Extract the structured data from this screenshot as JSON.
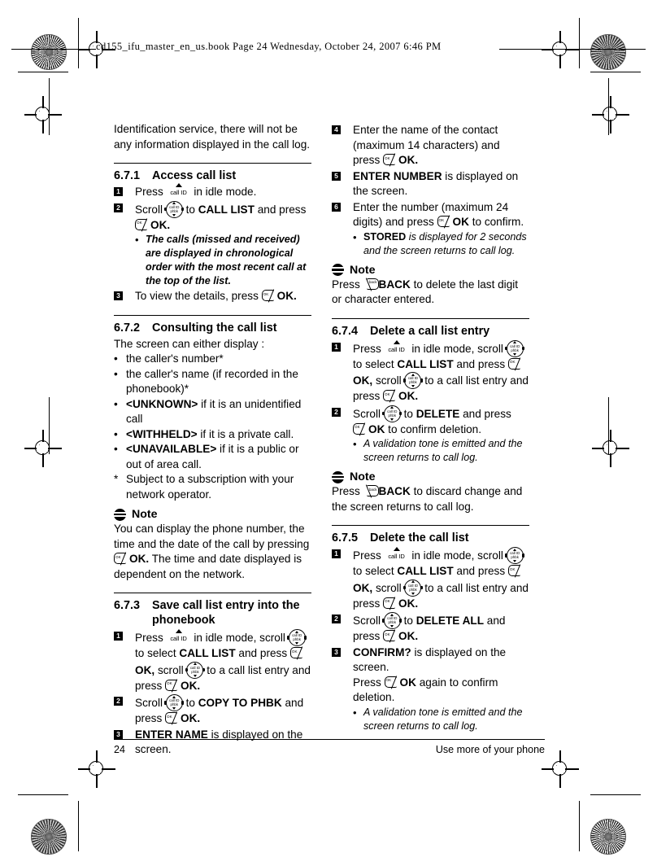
{
  "header": {
    "text": "cd155_ifu_master_en_us.book  Page 24  Wednesday, October 24, 2007  6:46 PM"
  },
  "footer": {
    "page_number": "24",
    "chapter_title": "Use more of your phone"
  },
  "keys": {
    "callid_label": "call ID",
    "nav_top": "call ID",
    "nav_bottom": "phbk",
    "ok_label": "OK",
    "back_label": "back"
  },
  "left_column": {
    "intro": "Identification service, there will not be any information displayed in the call log.",
    "section_671": {
      "number": "6.7.1",
      "title": "Access call list",
      "step1_a": "Press",
      "step1_b": "in idle mode.",
      "step2_a": "Scroll",
      "step2_b": "to",
      "step2_target": "CALL LIST",
      "step2_c": "and press",
      "step2_ok": "OK.",
      "step2_bullet": "The calls (missed and received) are displayed in chronological order with the most recent call at the top of the list.",
      "step3_a": "To view the details, press",
      "step3_ok": "OK."
    },
    "section_672": {
      "number": "6.7.2",
      "title": "Consulting the call list",
      "lead": "The screen can either display :",
      "bullets": [
        {
          "plain": "the caller's number*"
        },
        {
          "plain": "the caller's name (if recorded in the phonebook)*"
        },
        {
          "bold": "<UNKNOWN>",
          "plain": " if it is an unidentified call"
        },
        {
          "bold": "<WITHHELD>",
          "plain": " if it is a private call."
        },
        {
          "bold": "<UNAVAILABLE>",
          "plain": " if it is a public or out of area call."
        }
      ],
      "footnote_mark": "*",
      "footnote": "Subject to a subscription with your network operator."
    },
    "note_1": {
      "label": "Note",
      "text_a": "You can display the phone number, the time and the date of the call by pressing",
      "ok": "OK.",
      "text_b": "The time and date displayed is dependent on the network."
    },
    "section_673": {
      "number": "6.7.3",
      "title_line1": "Save call list entry into the",
      "title_line2": "phonebook",
      "step1_a": "Press",
      "step1_b": "in idle mode, scroll",
      "step1_c": "to select",
      "step1_target": "CALL LIST",
      "step1_d": "and press",
      "step1_ok1": "OK,",
      "step1_e": "scroll",
      "step1_f": "to a call list entry and press",
      "step1_ok2": "OK.",
      "step2_a": "Scroll",
      "step2_b": "to",
      "step2_target": "COPY TO PHBK",
      "step2_c": "and press",
      "step2_ok": "OK.",
      "step3_target": "ENTER NAME",
      "step3_text": "is displayed on the screen."
    }
  },
  "right_column": {
    "section_673_cont": {
      "step4_a": "Enter the name of the contact (maximum 14 characters) and press",
      "step4_ok": "OK.",
      "step5_target": "ENTER NUMBER",
      "step5_text": "is displayed on the screen.",
      "step6_a": "Enter the number (maximum 24 digits) and press",
      "step6_ok": "OK",
      "step6_b": "to confirm.",
      "step6_bullet_bold": "STORED",
      "step6_bullet_italic": "is displayed for 2 seconds and the screen returns to call log."
    },
    "note_2": {
      "label": "Note",
      "text_a": "Press",
      "back": "BACK",
      "text_b": "to delete the last digit or character entered."
    },
    "section_674": {
      "number": "6.7.4",
      "title": "Delete a call list entry",
      "step1_a": "Press",
      "step1_b": "in idle mode, scroll",
      "step1_c": "to select",
      "step1_target": "CALL LIST",
      "step1_d": "and press",
      "step1_ok1": "OK,",
      "step1_e": "scroll",
      "step1_f": "to a call list entry and press",
      "step1_ok2": "OK.",
      "step2_a": "Scroll",
      "step2_b": "to",
      "step2_target": "DELETE",
      "step2_c": "and press",
      "step2_ok": "OK",
      "step2_d": "to confirm deletion.",
      "step2_bullet": "A validation tone is emitted and the screen returns to call log."
    },
    "note_3": {
      "label": "Note",
      "text_a": "Press",
      "back": "BACK",
      "text_b": "to discard change and the screen returns to call log."
    },
    "section_675": {
      "number": "6.7.5",
      "title": "Delete the call list",
      "step1_a": "Press",
      "step1_b": "in idle mode, scroll",
      "step1_c": "to select",
      "step1_target": "CALL LIST",
      "step1_d": "and press",
      "step1_ok1": "OK,",
      "step1_e": "scroll",
      "step1_f": "to a call list entry and press",
      "step1_ok2": "OK.",
      "step2_a": "Scroll",
      "step2_b": "to",
      "step2_target": "DELETE ALL",
      "step2_c": "and press",
      "step2_ok": "OK.",
      "step3_target": "CONFIRM?",
      "step3_text": "is displayed on the screen.",
      "step3_b": "Press",
      "step3_ok": "OK",
      "step3_c": "again to confirm deletion.",
      "step3_bullet": "A validation tone is emitted and the screen returns to call log."
    }
  },
  "step_markers": {
    "s1": "1",
    "s2": "2",
    "s3": "3",
    "s4": "4",
    "s5": "5",
    "s6": "6"
  },
  "bullet_glyph": "•"
}
